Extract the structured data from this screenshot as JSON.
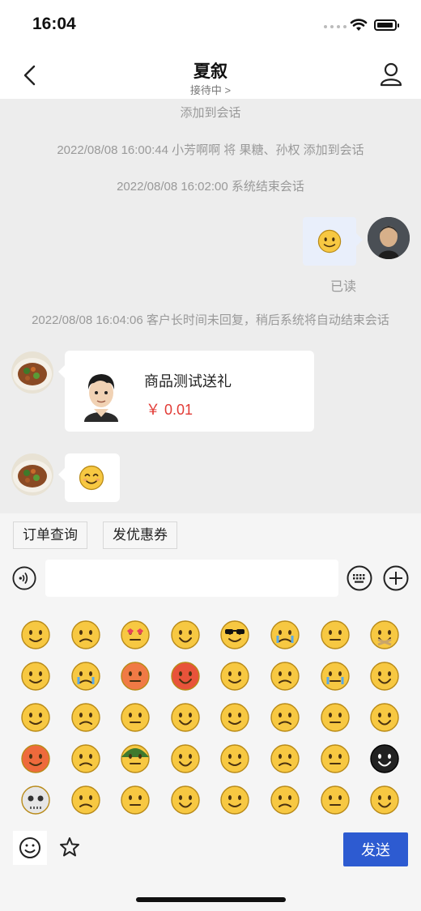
{
  "status_bar": {
    "time": "16:04"
  },
  "header": {
    "title": "夏叙",
    "subtitle": "接待中 >"
  },
  "chat": {
    "messages": [
      {
        "type": "system",
        "text": "添加到会话"
      },
      {
        "type": "system",
        "text": "2022/08/08 16:00:44 小芳啊啊 将 果糖、孙权 添加到会话"
      },
      {
        "type": "system",
        "text": "2022/08/08 16:02:00 系统结束会话"
      },
      {
        "type": "outgoing",
        "content": "smile-emoji",
        "status": "已读"
      },
      {
        "type": "system",
        "text": "2022/08/08 16:04:06 客户长时间未回复，稍后系统将自动结束会话"
      },
      {
        "type": "incoming-product",
        "name": "商品测试送礼",
        "price": "￥ 0.01"
      },
      {
        "type": "incoming",
        "content": "happy-emoji"
      }
    ]
  },
  "quick_actions": [
    "订单查询",
    "发优惠券"
  ],
  "input": {
    "value": "",
    "placeholder": ""
  },
  "emoji_panel": {
    "rows": [
      [
        "smile",
        "sad-worried",
        "heart-eyes",
        "angry-squint",
        "cool-sunglasses",
        "crying-loud",
        "frown-annoyed",
        "mouth-zipped"
      ],
      [
        "sleepy",
        "laugh-cry",
        "hot-sweat",
        "angry-red",
        "tongue-wink",
        "big-grin",
        "tearful",
        "frown"
      ],
      [
        "surprised",
        "grin-laugh",
        "sick",
        "thinking",
        "blush",
        "shocked",
        "confused",
        "meh"
      ],
      [
        "angry-cussing",
        "grin-teeth",
        "soldier-helmet",
        "shy-laugh",
        "question",
        "shush",
        "dizzy",
        "black-sweat"
      ],
      [
        "skull",
        "knocked",
        "hand-on-chin",
        "cool-sweat",
        "kissing",
        "pray",
        "toothy",
        "smirk"
      ]
    ]
  },
  "tabs": {
    "send_label": "发送"
  },
  "colors": {
    "accent": "#2d5bd1",
    "price": "#e23b36",
    "emoji_yellow": "#f7c842"
  }
}
